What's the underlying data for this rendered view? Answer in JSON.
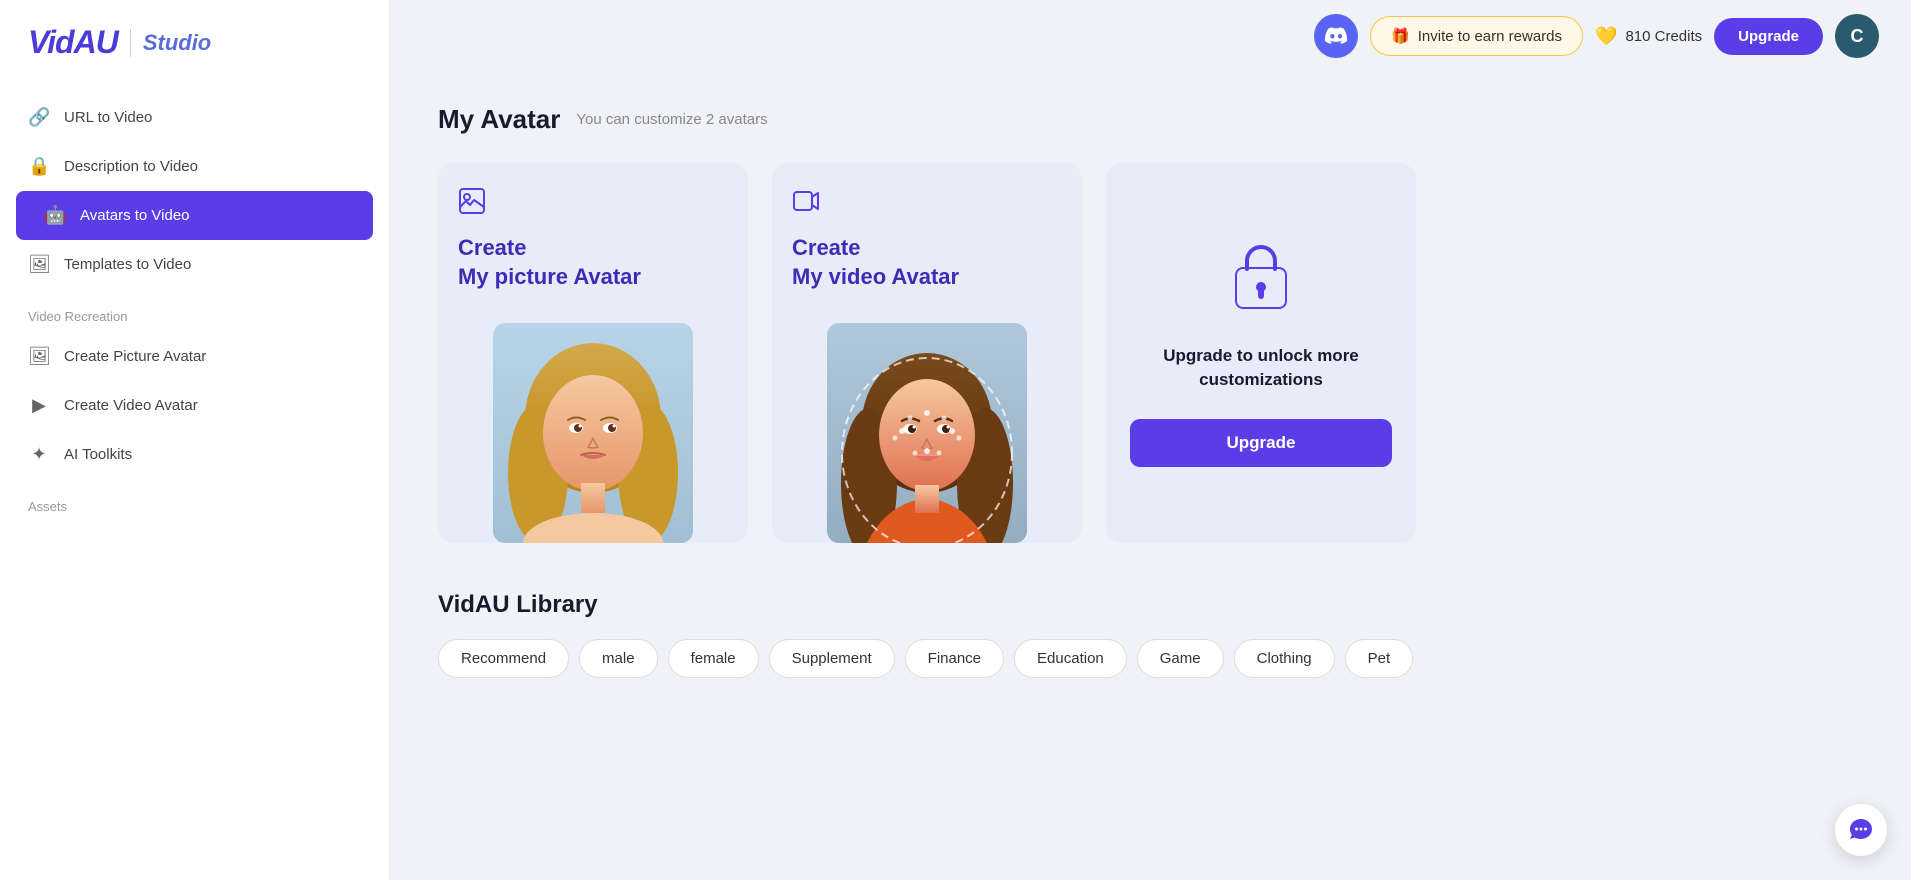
{
  "logo": {
    "brand": "VidAU",
    "product": "Studio"
  },
  "sidebar": {
    "nav_items": [
      {
        "id": "url-to-video",
        "label": "URL to Video",
        "icon": "🔗",
        "active": false
      },
      {
        "id": "description-to-video",
        "label": "Description to Video",
        "icon": "🔒",
        "active": false
      },
      {
        "id": "avatars-to-video",
        "label": "Avatars to Video",
        "icon": "🤖",
        "active": true
      },
      {
        "id": "templates-to-video",
        "label": "Templates to Video",
        "icon": "🖼",
        "active": false
      }
    ],
    "section_video_recreation": "Video Recreation",
    "video_recreation_items": [
      {
        "id": "create-picture-avatar",
        "label": "Create Picture Avatar",
        "icon": "🖼"
      },
      {
        "id": "create-video-avatar",
        "label": "Create Video Avatar",
        "icon": "▶"
      },
      {
        "id": "ai-toolkits",
        "label": "AI Toolkits",
        "icon": "✦"
      }
    ],
    "section_assets": "Assets"
  },
  "header": {
    "discord_label": "Discord",
    "invite_label": "Invite to earn rewards",
    "invite_icon": "🎁",
    "credits_icon": "💛",
    "credits_value": "810 Credits",
    "upgrade_label": "Upgrade",
    "user_initial": "C"
  },
  "page": {
    "title": "My Avatar",
    "subtitle": "You can customize 2 avatars"
  },
  "avatar_cards": [
    {
      "id": "picture-avatar-card",
      "icon": "🖼",
      "title_line1": "Create",
      "title_line2": "My picture Avatar",
      "type": "picture"
    },
    {
      "id": "video-avatar-card",
      "icon": "▶",
      "title_line1": "Create",
      "title_line2": "My video Avatar",
      "type": "video"
    }
  ],
  "upgrade_card": {
    "lock_icon": "🔒",
    "text": "Upgrade to unlock more customizations",
    "button_label": "Upgrade"
  },
  "library": {
    "title": "VidAU Library",
    "filters": [
      {
        "id": "recommend",
        "label": "Recommend"
      },
      {
        "id": "male",
        "label": "male"
      },
      {
        "id": "female",
        "label": "female"
      },
      {
        "id": "supplement",
        "label": "Supplement"
      },
      {
        "id": "finance",
        "label": "Finance"
      },
      {
        "id": "education",
        "label": "Education"
      },
      {
        "id": "game",
        "label": "Game"
      },
      {
        "id": "clothing",
        "label": "Clothing"
      },
      {
        "id": "pet",
        "label": "Pet"
      }
    ]
  },
  "chat": {
    "icon": "💬"
  }
}
